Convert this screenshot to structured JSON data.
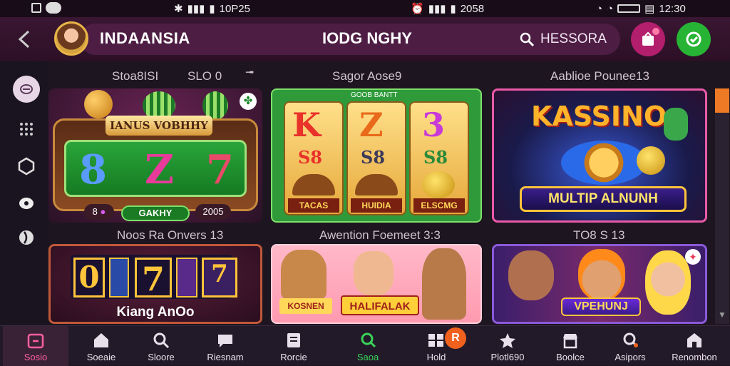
{
  "status": {
    "left_time": "10P25",
    "mid_time": "2058",
    "right_time": "12:30"
  },
  "header": {
    "app_name": "INDAANSIA",
    "page_title": "IODG NGHY",
    "search_placeholder": "HESSORA"
  },
  "sections": {
    "s1_a": "Stoa8ISI",
    "s1_b": "SLO 0",
    "s2": "Sagor Aose9",
    "s3": "Aablioe Pounee13",
    "s4": "Noos Ra Onvers 13",
    "s5": "Awention Foemeet 3:3",
    "s6": "TO8 S 13"
  },
  "games": {
    "g1": {
      "banner": "IANUS VOBHHY",
      "reels": [
        "8",
        "Z",
        "7"
      ],
      "btn_left": "8",
      "btn_mid": "GAKHY",
      "btn_right": "2005"
    },
    "g2": {
      "top": "GOOB BANTT",
      "reels": [
        "K",
        "Z",
        "3"
      ],
      "mid": [
        "S8",
        "S8",
        "S8"
      ],
      "b1": "TACAS",
      "b2": "HUIDIA",
      "b3": "ELSCMG"
    },
    "g3": {
      "title": "KASSINO",
      "banner": "MULTIP ALNUNH"
    },
    "g4": {
      "reels": [
        "0",
        "7",
        "7"
      ],
      "title": "Kiang AnOo"
    },
    "g5": {
      "left": "KOSNEN",
      "right": "HALIFALAK"
    },
    "g6": {
      "title": "VPEHUNJ"
    }
  },
  "nav": [
    {
      "label": "Sosio",
      "icon": "home-icon"
    },
    {
      "label": "Soeaie",
      "icon": "house-icon"
    },
    {
      "label": "Sloore",
      "icon": "search-icon"
    },
    {
      "label": "Riesnam",
      "icon": "chat-icon"
    },
    {
      "label": "Rorcie",
      "icon": "list-icon"
    },
    {
      "label": "Saoa",
      "icon": "magnifier-icon"
    },
    {
      "label": "Hold",
      "icon": "grid-icon",
      "badge": "R"
    },
    {
      "label": "Plotl690",
      "icon": "star-icon"
    },
    {
      "label": "Boolce",
      "icon": "shop-icon"
    },
    {
      "label": "Asipors",
      "icon": "bell-icon"
    },
    {
      "label": "Renombon",
      "icon": "gift-icon"
    }
  ],
  "colors": {
    "accent": "#ff5fa2",
    "header_bg": "#3a1632",
    "orange": "#ef7a26"
  }
}
